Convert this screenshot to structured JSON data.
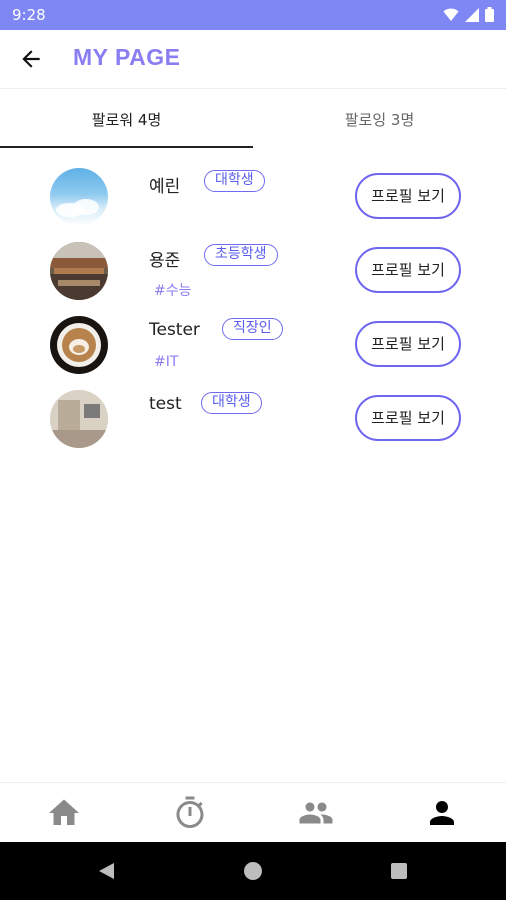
{
  "status_bar": {
    "time": "9:28",
    "icons": [
      "wifi-icon",
      "cell-signal-icon",
      "battery-icon"
    ]
  },
  "app_bar": {
    "title": "MY PAGE",
    "back_icon": "arrow-back-icon"
  },
  "tabs": [
    {
      "label": "팔로워 4명",
      "active": true
    },
    {
      "label": "팔로잉 3명",
      "active": false
    }
  ],
  "users": [
    {
      "name": "예린",
      "tag": "대학생",
      "hashtag": "",
      "avatar": "sky-photo",
      "button": "프로필 보기"
    },
    {
      "name": "용준",
      "tag": "초등학생",
      "hashtag": "#수능",
      "avatar": "street-market-photo",
      "button": "프로필 보기"
    },
    {
      "name": "Tester",
      "tag": "직장인",
      "hashtag": "#IT",
      "avatar": "latte-art-photo",
      "button": "프로필 보기"
    },
    {
      "name": "test",
      "tag": "대학생",
      "hashtag": "",
      "avatar": "desk-photo",
      "button": "프로필 보기"
    }
  ],
  "bottom_nav": [
    {
      "name": "home-icon",
      "active": false
    },
    {
      "name": "timer-icon",
      "active": false
    },
    {
      "name": "people-icon",
      "active": false
    },
    {
      "name": "person-icon",
      "active": true
    }
  ],
  "system_nav": [
    "back-triangle-icon",
    "home-circle-icon",
    "recents-square-icon"
  ],
  "colors": {
    "status_bar": "#7f87f5",
    "accent": "#8a7ef3",
    "tag_border": "#6f6bf2",
    "nav_inactive": "#8a8a8a"
  }
}
